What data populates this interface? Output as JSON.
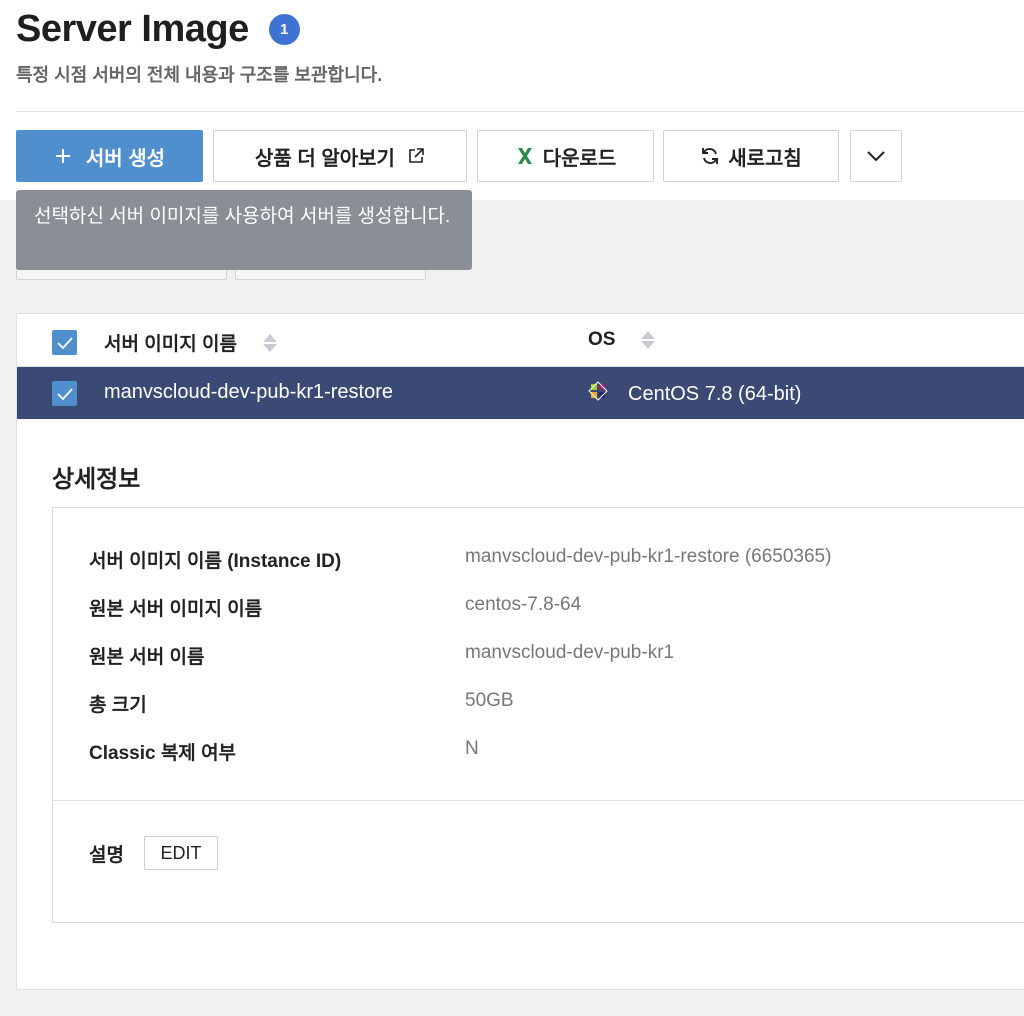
{
  "header": {
    "title": "Server Image",
    "count_badge": "1",
    "subtitle": "특정 시점 서버의 전체 내용과 구조를 보관합니다."
  },
  "toolbar": {
    "create_label": "서버 생성",
    "learn_more_label": "상품 더 알아보기",
    "download_label": "다운로드",
    "refresh_label": "새로고침"
  },
  "tooltip": {
    "text": "선택하신 서버 이미지를 사용하여 서버를 생성합니다."
  },
  "table": {
    "columns": [
      "서버 이미지 이름",
      "OS"
    ],
    "rows": [
      {
        "name": "manvscloud-dev-pub-kr1-restore",
        "os": "CentOS 7.8 (64-bit)",
        "selected": true
      }
    ]
  },
  "detail": {
    "title": "상세정보",
    "fields": [
      {
        "label": "서버 이미지 이름 (Instance ID)",
        "value": "manvscloud-dev-pub-kr1-restore (6650365)"
      },
      {
        "label": "원본 서버 이미지 이름",
        "value": "centos-7.8-64"
      },
      {
        "label": "원본 서버 이름",
        "value": "manvscloud-dev-pub-kr1"
      },
      {
        "label": "총 크기",
        "value": "50GB"
      },
      {
        "label": "Classic 복제 여부",
        "value": "N"
      }
    ],
    "description_label": "설명",
    "edit_label": "EDIT"
  },
  "colors": {
    "primary": "#4f8fce",
    "badge": "#3f73d3",
    "selected_row": "#3b4a75",
    "tooltip_bg": "#8a8f96"
  }
}
